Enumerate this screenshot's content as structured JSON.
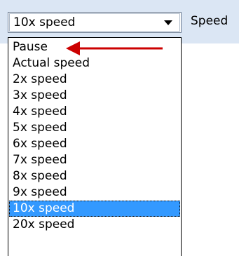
{
  "combo": {
    "value": "10x speed",
    "icon": "chevron-down-icon"
  },
  "speed_label": "Speed",
  "dropdown": {
    "options": [
      "Pause",
      "Actual speed",
      "2x speed",
      "3x speed",
      "4x speed",
      "5x speed",
      "6x speed",
      "7x speed",
      "8x speed",
      "9x speed",
      "10x speed",
      "20x speed"
    ],
    "selected_index": 10
  },
  "annotation": {
    "color": "#cc0000",
    "points_to": "Pause"
  },
  "colors": {
    "toolbar_bg": "#dbe6f4",
    "selection_bg": "#3399ff"
  }
}
